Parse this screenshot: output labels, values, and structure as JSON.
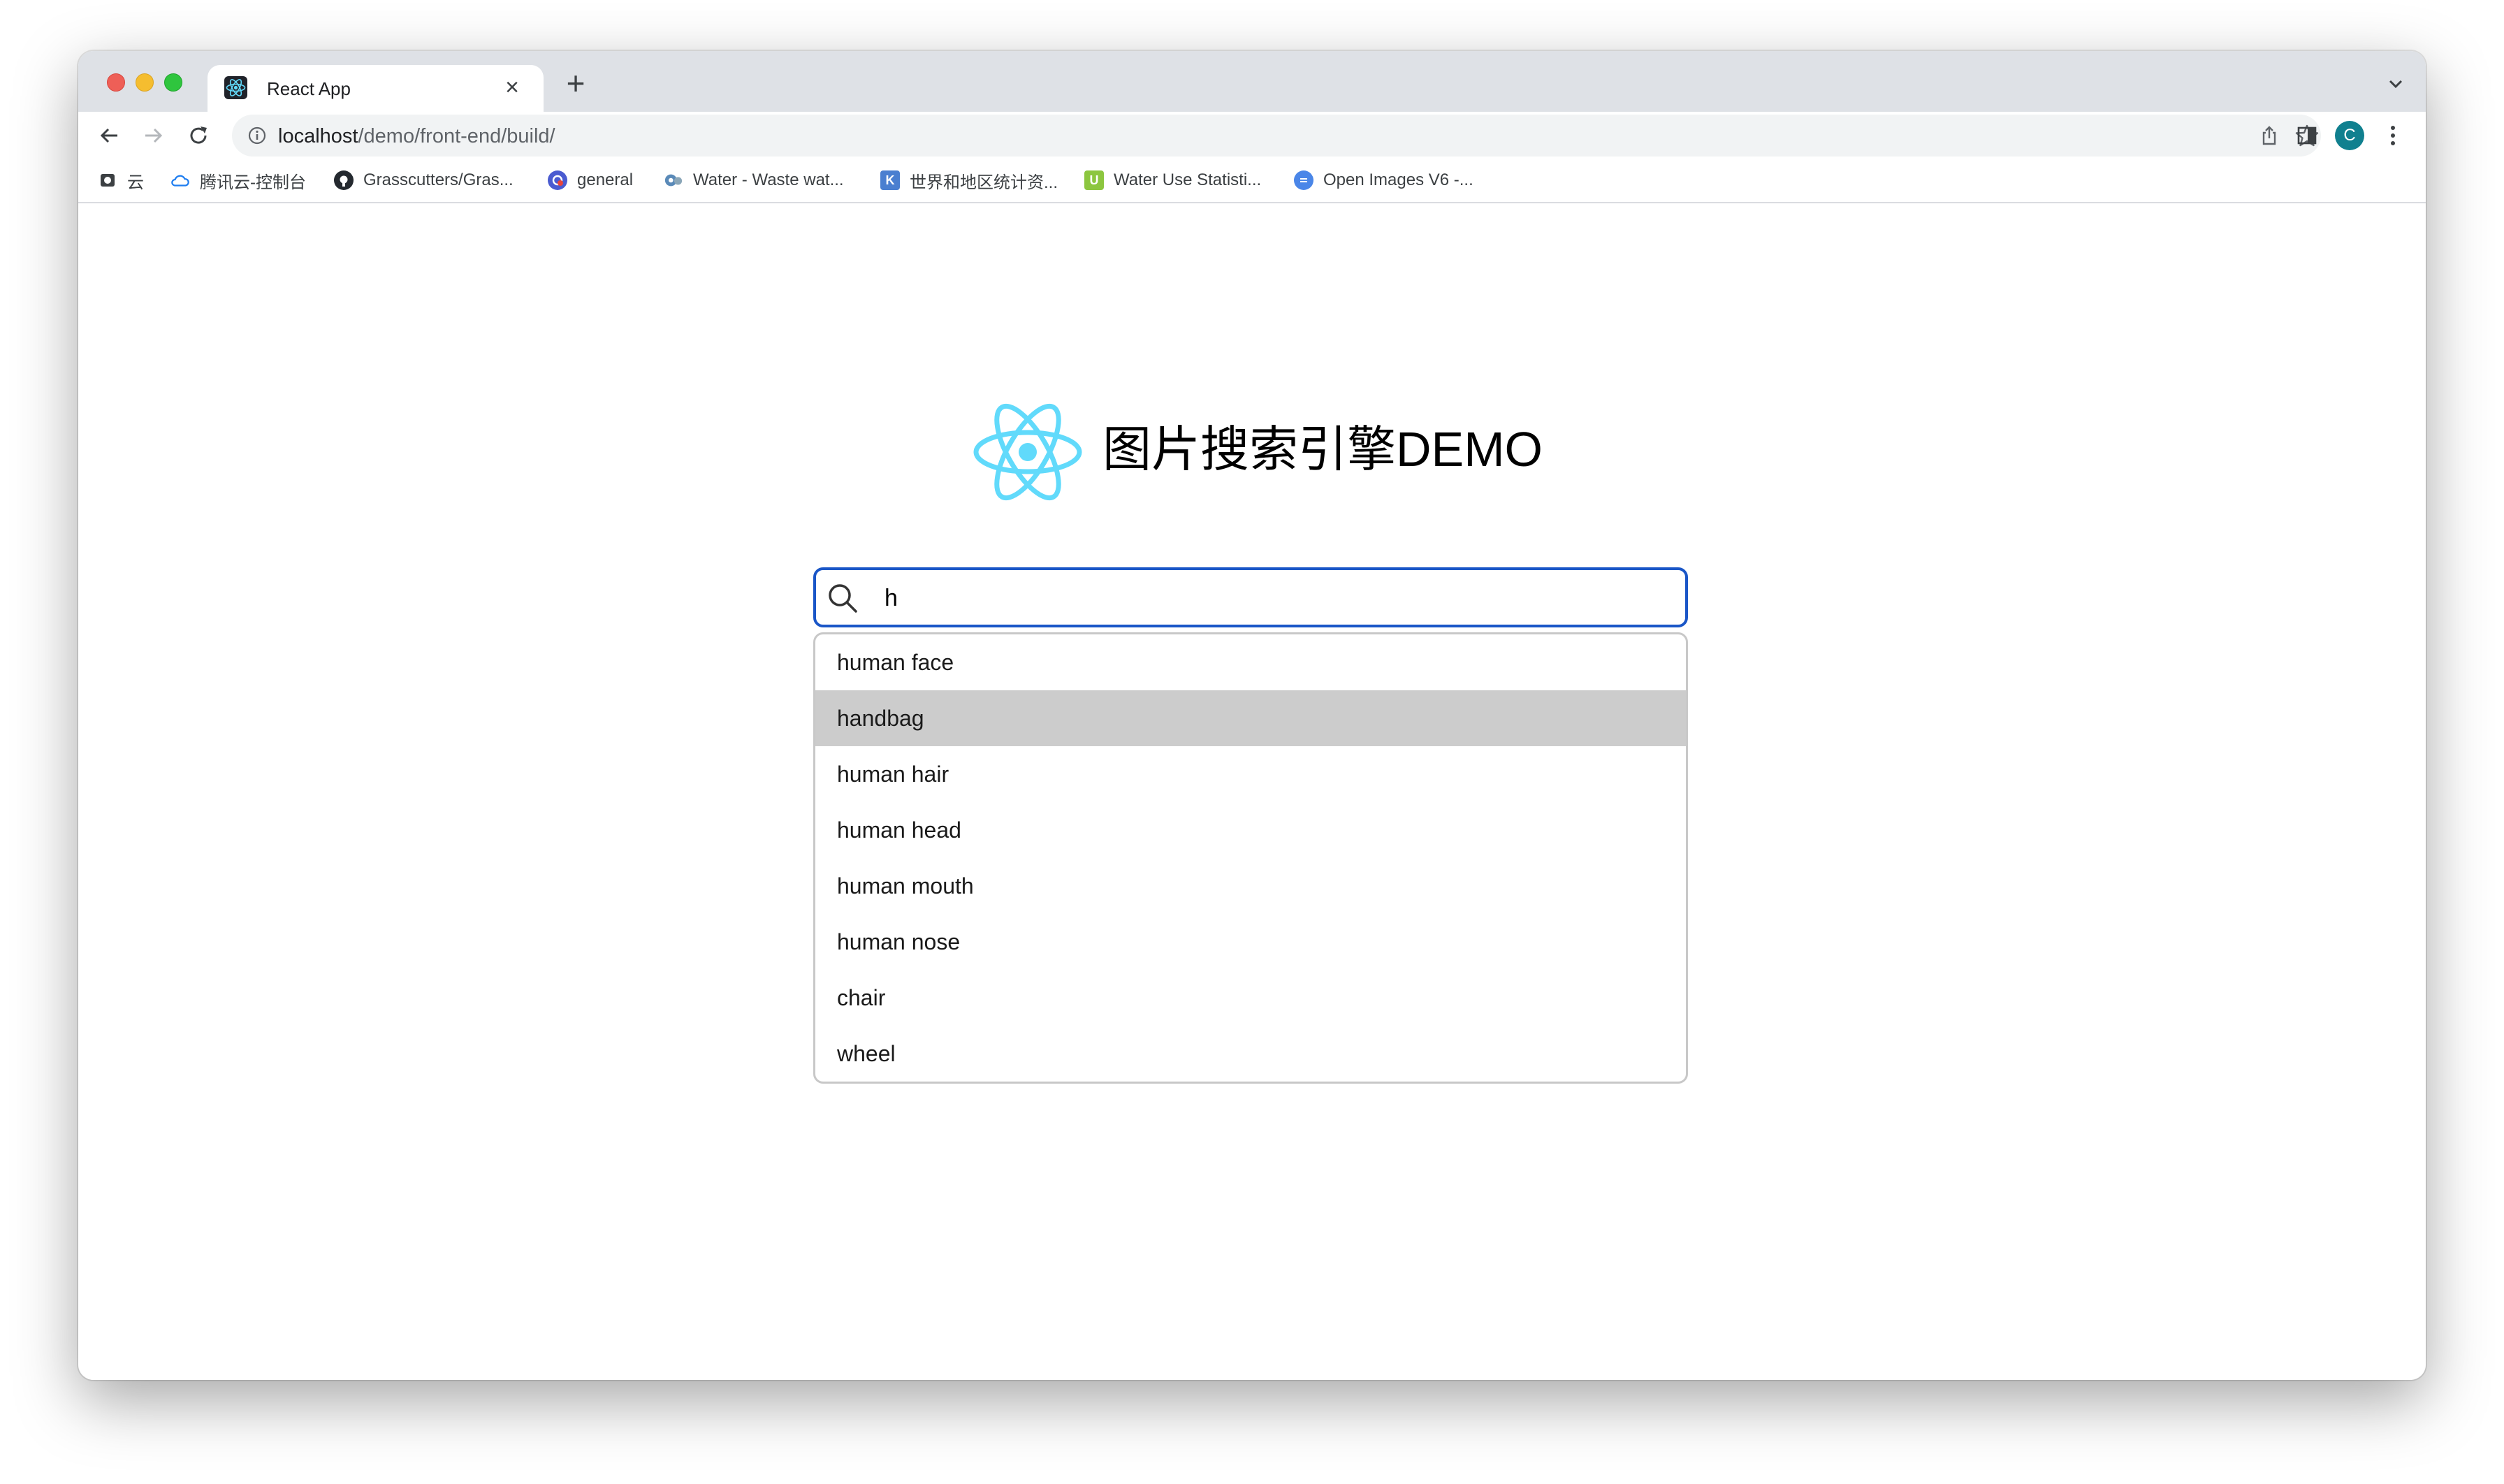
{
  "browser": {
    "tab_title": "React App",
    "address": {
      "host": "localhost",
      "path": "/demo/front-end/build/"
    },
    "profile_initial": "C",
    "bookmarks": [
      {
        "label": "云",
        "icon": "tencent-icon",
        "color": "#3c4043"
      },
      {
        "label": "腾讯云-控制台",
        "icon": "cloud-icon",
        "color": "#1f7ef0"
      },
      {
        "label": "Grasscutters/Gras...",
        "icon": "github-icon",
        "color": "#24292f"
      },
      {
        "label": "general",
        "icon": "general-icon",
        "color": "#e8453c"
      },
      {
        "label": "Water - Waste wat...",
        "icon": "globe-icon",
        "color": "#5a8ab8"
      },
      {
        "label": "世界和地区统计资...",
        "icon": "k-icon",
        "color": "#4a7fd0"
      },
      {
        "label": "Water Use Statisti...",
        "icon": "u-icon",
        "color": "#8cc63f"
      },
      {
        "label": "Open Images V6 -...",
        "icon": "open-images-icon",
        "color": "#4a86e8"
      }
    ]
  },
  "page": {
    "heading": "图片搜索引擎DEMO",
    "logo_color": "#61dafb",
    "search": {
      "value": "h",
      "focus_color": "#1a56c7"
    },
    "suggestions": [
      {
        "label": "human face",
        "active": false
      },
      {
        "label": "handbag",
        "active": true
      },
      {
        "label": "human hair",
        "active": false
      },
      {
        "label": "human head",
        "active": false
      },
      {
        "label": "human mouth",
        "active": false
      },
      {
        "label": "human nose",
        "active": false
      },
      {
        "label": "chair",
        "active": false
      },
      {
        "label": "wheel",
        "active": false
      }
    ]
  }
}
